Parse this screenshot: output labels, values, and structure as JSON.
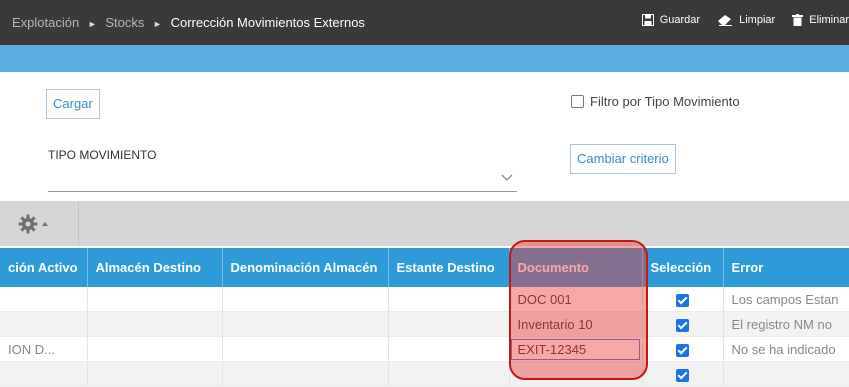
{
  "breadcrumb": {
    "items": [
      "Explotación",
      "Stocks",
      "Corrección Movimientos Externos"
    ],
    "separator": "►"
  },
  "toolbar": {
    "save_label": "Guardar",
    "clear_label": "Limpiar",
    "delete_label": "Eliminar"
  },
  "form": {
    "load_button": "Cargar",
    "filter_checkbox_label": "Filtro por Tipo Movimiento",
    "filter_checked": false,
    "tipo_label": "TIPO MOVIMIENTO",
    "tipo_value": "",
    "change_criteria_button": "Cambiar criterio"
  },
  "grid": {
    "columns": [
      "ción Activo",
      "Almacén Destino",
      "Denominación Almacén",
      "Estante Destino",
      "Documento",
      "Selección",
      "Error"
    ],
    "rows": [
      {
        "activo": "",
        "almacen": "",
        "denominacion": "",
        "estante": "",
        "documento": "DOC 001",
        "seleccion": true,
        "error": "Los campos Estan"
      },
      {
        "activo": "",
        "almacen": "",
        "denominacion": "",
        "estante": "",
        "documento": "Inventario 10",
        "seleccion": true,
        "error": "El registro NM no"
      },
      {
        "activo": "ION D...",
        "almacen": "",
        "denominacion": "",
        "estante": "",
        "documento": "EXIT-12345",
        "seleccion": true,
        "error": "No se ha indicado"
      }
    ]
  },
  "colors": {
    "topbar": "#3a3a3a",
    "accent_bar": "#5aaee0",
    "grid_header": "#2f9ad8",
    "highlight": "#c01818"
  }
}
